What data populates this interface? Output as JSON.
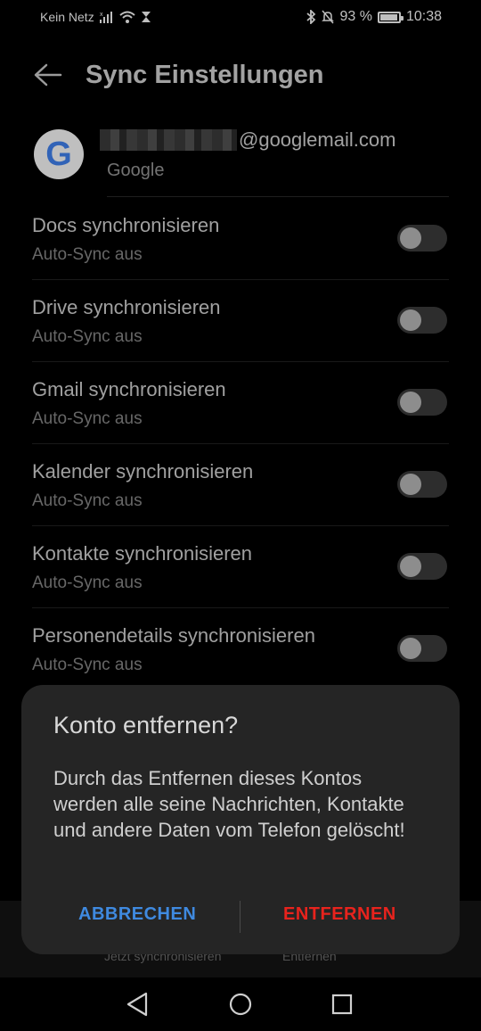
{
  "status_bar": {
    "carrier": "Kein Netz",
    "battery": "93 %",
    "battery_level": 0.93,
    "time": "10:38"
  },
  "header": {
    "title": "Sync Einstellungen"
  },
  "account": {
    "email_suffix": "@googlemail.com",
    "provider": "Google",
    "avatar_letter": "G"
  },
  "sync_items": [
    {
      "label": "Docs synchronisieren",
      "status": "Auto-Sync aus",
      "enabled": false
    },
    {
      "label": "Drive synchronisieren",
      "status": "Auto-Sync aus",
      "enabled": false
    },
    {
      "label": "Gmail synchronisieren",
      "status": "Auto-Sync aus",
      "enabled": false
    },
    {
      "label": "Kalender synchronisieren",
      "status": "Auto-Sync aus",
      "enabled": false
    },
    {
      "label": "Kontakte synchronisieren",
      "status": "Auto-Sync aus",
      "enabled": false
    },
    {
      "label": "Personendetails synchronisieren",
      "status": "Auto-Sync aus",
      "enabled": false
    }
  ],
  "bottom_actions": {
    "sync_now": "Jetzt synchronisieren",
    "remove": "Entfernen"
  },
  "dialog": {
    "title": "Konto entfernen?",
    "body": "Durch das Entfernen dieses Kontos werden alle seine Nachrichten, Kontakte und andere Daten vom Telefon gelöscht!",
    "cancel_label": "ABBRECHEN",
    "confirm_label": "ENTFERNEN",
    "cancel_color": "#3f8ae0",
    "confirm_color": "#e8231d"
  }
}
